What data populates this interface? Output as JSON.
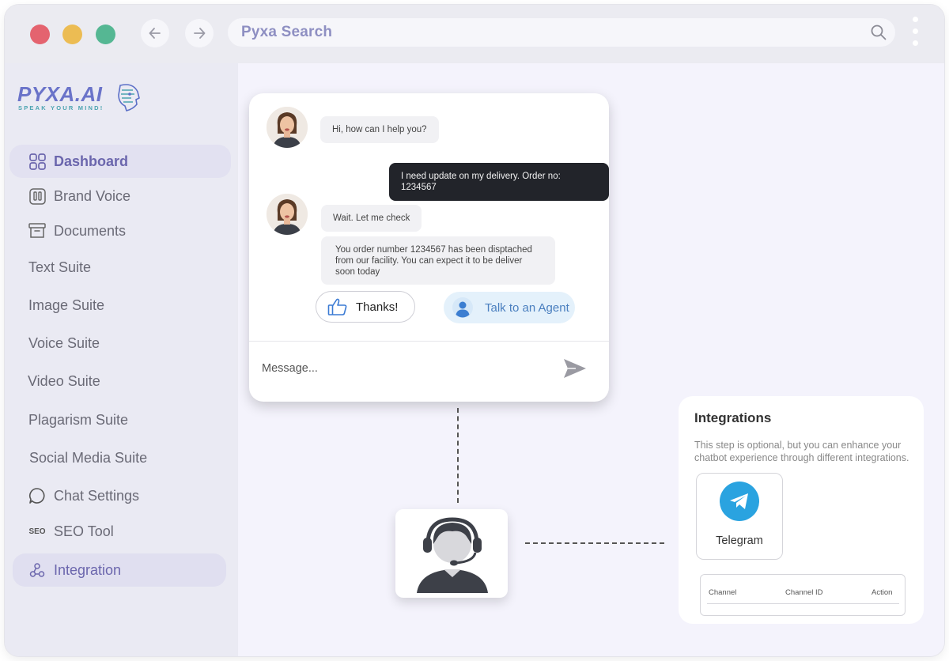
{
  "browser": {
    "url_text": "Pyxa Search"
  },
  "brand": {
    "logo_word": "PYXA.AI",
    "tagline": "SPEAK YOUR MIND!"
  },
  "sidebar": {
    "items": [
      {
        "label": "Dashboard",
        "icon": "grid-icon"
      },
      {
        "label": "Brand Voice",
        "icon": "pause-box-icon"
      },
      {
        "label": "Documents",
        "icon": "archive-icon"
      },
      {
        "label": "Text Suite"
      },
      {
        "label": "Image Suite"
      },
      {
        "label": "Voice Suite"
      },
      {
        "label": "Video Suite"
      },
      {
        "label": "Plagarism Suite"
      },
      {
        "label": "Social Media Suite"
      },
      {
        "label": "Chat Settings",
        "icon": "chat-bubble-icon"
      },
      {
        "label": "SEO Tool",
        "icon": "seo-icon",
        "glyph": "SEO"
      },
      {
        "label": "Integration",
        "icon": "integration-icon"
      }
    ]
  },
  "chat": {
    "messages": [
      {
        "from": "bot",
        "text": "Hi, how can I help you?"
      },
      {
        "from": "user",
        "text": "I need update on my delivery. Order no: 1234567"
      },
      {
        "from": "bot",
        "text": "Wait. Let me check"
      },
      {
        "from": "bot",
        "text": "You order number 1234567 has been disptached from our facility. You can expect it to be deliver soon today"
      }
    ],
    "quick_replies": {
      "thanks": "Thanks!",
      "agent": "Talk to an Agent"
    },
    "input_placeholder": "Message..."
  },
  "integrations": {
    "title": "Integrations",
    "description": "This step is optional, but you can enhance your chatbot experience through different integrations.",
    "telegram_label": "Telegram",
    "table_headers": [
      "Channel",
      "Channel ID",
      "Action"
    ]
  },
  "colors": {
    "accent": "#6b66ad",
    "telegram": "#2aa3e0",
    "user_bubble": "#22242a"
  }
}
